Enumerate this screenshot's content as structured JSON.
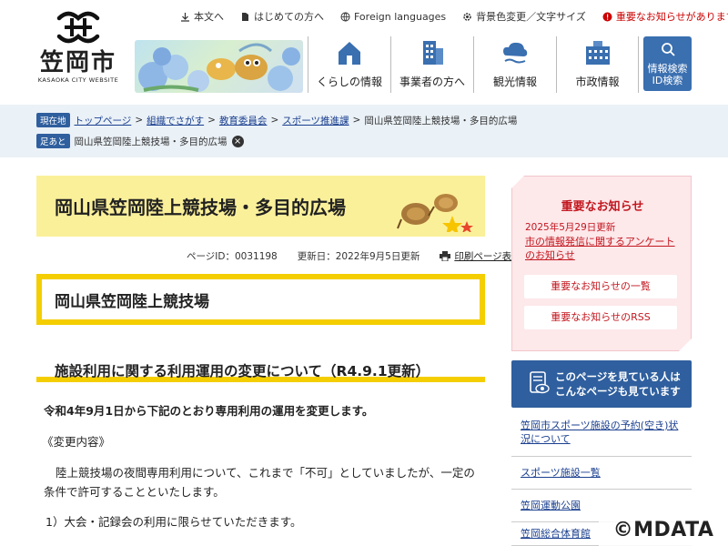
{
  "site": {
    "logo_text": "笠岡市",
    "logo_sub": "KASAOKA CITY WEBSITE"
  },
  "toplinks": [
    {
      "label": "本文へ",
      "icon": "download-arrow-icon"
    },
    {
      "label": "はじめての方へ",
      "icon": "bookmark-icon"
    },
    {
      "label": "Foreign languages",
      "icon": "globe-icon"
    },
    {
      "label": "背景色変更／文字サイズ",
      "icon": "gear-icon"
    },
    {
      "label": "重要なお知らせがあります",
      "icon": "alert-icon"
    }
  ],
  "nav": [
    {
      "label": "くらしの情報",
      "icon": "house-icon"
    },
    {
      "label": "事業者の方へ",
      "icon": "building-icon"
    },
    {
      "label": "観光情報",
      "icon": "cloud-icon"
    },
    {
      "label": "市政情報",
      "icon": "city-hall-icon"
    }
  ],
  "search_button": {
    "line1": "情報検索",
    "line2": "ID検索"
  },
  "breadcrumb": {
    "current_tag": "現在地",
    "items": [
      "トップページ",
      "組織でさがす",
      "教育委員会",
      "スポーツ推進課"
    ],
    "current": "岡山県笠岡陸上競技場・多目的広場",
    "footprint_tag": "足あと",
    "footprint_item": "岡山県笠岡陸上競技場・多目的広場"
  },
  "page": {
    "title": "岡山県笠岡陸上競技場・多目的広場",
    "page_id": "ページID：0031198",
    "updated": "更新日：2022年9月5日更新",
    "print": "印刷ページ表示",
    "h2": "岡山県笠岡陸上競技場",
    "h3": "施設利用に関する利用運用の変更について（R4.9.1更新）",
    "paragraphs": [
      "令和4年9月1日から下記のとおり専用利用の運用を変更します。",
      "《変更内容》",
      "陸上競技場の夜間専用利用について、これまで「不可」としていましたが、一定の条件で許可することといたします。",
      "1）大会・記録会の利用に限らせていただきます。"
    ]
  },
  "notice": {
    "title": "重要なお知らせ",
    "date": "2025年5月29日更新",
    "link": "市の情報発信に関するアンケートのお知らせ",
    "btn_list": "重要なお知らせの一覧",
    "btn_rss": "重要なお知らせのRSS"
  },
  "related": {
    "head_line1": "このページを見ている人は",
    "head_line2": "こんなページも見ています",
    "items": [
      "笠岡市スポーツ施設の予約(空き)状況について",
      "スポーツ施設一覧",
      "笠岡運動公園",
      "笠岡総合体育館"
    ]
  },
  "watermark": "©MDATA",
  "colors": {
    "accent_blue": "#2f5f9e",
    "accent_yellow": "#f4ce00",
    "alert_red": "#c2171f"
  }
}
